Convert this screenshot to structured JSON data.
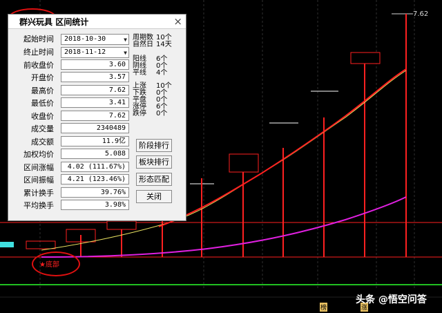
{
  "dialog": {
    "app_name": "群兴玩具",
    "title": "区间统计",
    "close_glyph": "×",
    "fields": [
      {
        "label": "起始时间",
        "value": "2018-10-30",
        "type": "date"
      },
      {
        "label": "终止时间",
        "value": "2018-11-12",
        "type": "date"
      },
      {
        "label": "前收盘价",
        "value": "3.60"
      },
      {
        "label": "开盘价",
        "value": "3.57"
      },
      {
        "label": "最高价",
        "value": "7.62"
      },
      {
        "label": "最低价",
        "value": "3.41"
      },
      {
        "label": "收盘价",
        "value": "7.62"
      },
      {
        "label": "成交量",
        "value": "2340489"
      },
      {
        "label": "成交额",
        "value": "11.9亿"
      },
      {
        "label": "加权均价",
        "value": "5.088"
      },
      {
        "label": "区间涨幅",
        "value": "4.02 (111.67%)"
      },
      {
        "label": "区间振幅",
        "value": "4.21 (123.46%)"
      },
      {
        "label": "累计换手",
        "value": "39.76%"
      },
      {
        "label": "平均换手",
        "value": "3.98%"
      }
    ],
    "stats": [
      {
        "label": "周期数",
        "value": "10个"
      },
      {
        "label": "自然日",
        "value": "14天"
      },
      {
        "label": "阳线",
        "value": "6个"
      },
      {
        "label": "阴线",
        "value": "0个"
      },
      {
        "label": "平线",
        "value": "4个"
      },
      {
        "label": "上涨",
        "value": "10个"
      },
      {
        "label": "下跌",
        "value": "0个"
      },
      {
        "label": "平盘",
        "value": "0个"
      },
      {
        "label": "涨停",
        "value": "6个"
      },
      {
        "label": "跌停",
        "value": "0个"
      }
    ],
    "buttons": [
      "阶段排行",
      "板块排行",
      "形态匹配",
      "关闭"
    ]
  },
  "chart": {
    "high_price_label": "7.62",
    "low_label": "★底部",
    "bottom_markers": [
      "榜",
      "涨"
    ],
    "colors": {
      "up_candle": "#ff2020",
      "flat_candle": "#ffffff",
      "ma_red": "#ff2020",
      "ma_yellow": "#e8e060",
      "ma_magenta": "#e020e0",
      "baseline": "#20c020",
      "accent_cyan": "#40e0e0"
    }
  },
  "watermark": "头条 @悟空问答"
}
